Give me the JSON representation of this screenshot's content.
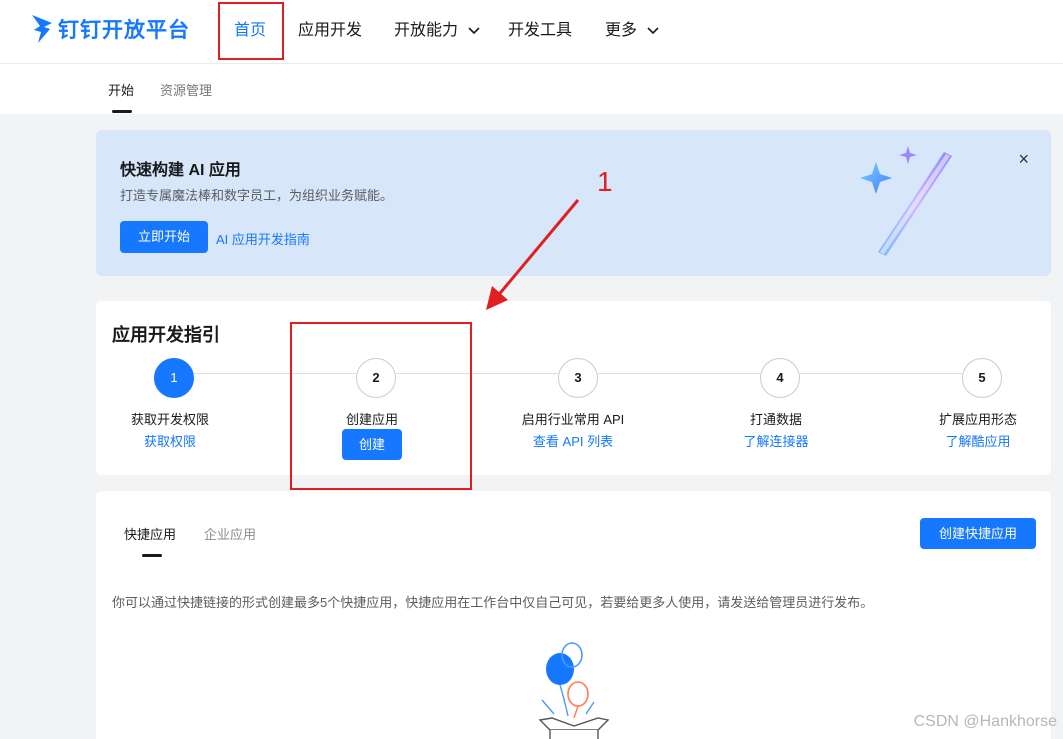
{
  "brand": {
    "name": "钉钉开放平台",
    "color": "#1677ff"
  },
  "topnav": {
    "items": [
      {
        "label": "首页"
      },
      {
        "label": "应用开发"
      },
      {
        "label": "开放能力"
      },
      {
        "label": "开发工具"
      },
      {
        "label": "更多"
      }
    ]
  },
  "subnav": {
    "tabs": [
      {
        "label": "开始"
      },
      {
        "label": "资源管理"
      }
    ]
  },
  "banner": {
    "title": "快速构建 AI 应用",
    "subtitle": "打造专属魔法棒和数字员工，为组织业务赋能。",
    "start_button": "立即开始",
    "guide_link": "AI 应用开发指南",
    "close_label": "×"
  },
  "guide": {
    "title": "应用开发指引",
    "steps": [
      {
        "num": "1",
        "label": "获取开发权限",
        "action": "获取权限"
      },
      {
        "num": "2",
        "label": "创建应用",
        "action": "创建"
      },
      {
        "num": "3",
        "label": "启用行业常用 API",
        "action": "查看 API 列表"
      },
      {
        "num": "4",
        "label": "打通数据",
        "action": "了解连接器"
      },
      {
        "num": "5",
        "label": "扩展应用形态",
        "action": "了解酷应用"
      }
    ]
  },
  "annotation": {
    "number": "1",
    "color": "#e02020"
  },
  "apps": {
    "tabs": [
      {
        "label": "快捷应用"
      },
      {
        "label": "企业应用"
      }
    ],
    "create_button": "创建快捷应用",
    "description": "你可以通过快捷链接的形式创建最多5个快捷应用，快捷应用在工作台中仅自己可见，若要给更多人使用，请发送给管理员进行发布。"
  },
  "watermark": "CSDN @Hankhorse"
}
